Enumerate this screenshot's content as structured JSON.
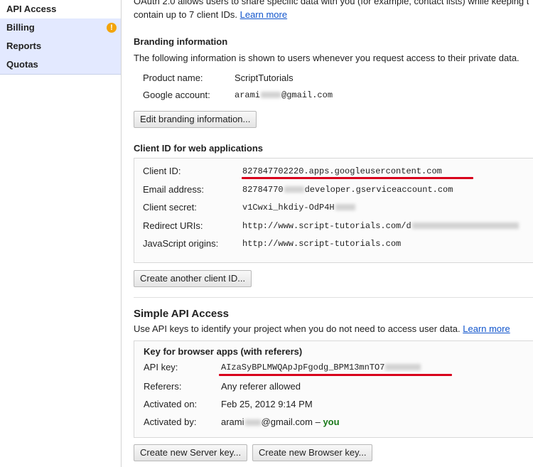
{
  "sidebar": {
    "items": [
      {
        "label": "API Access"
      },
      {
        "label": "Billing",
        "warning": "!"
      },
      {
        "label": "Reports"
      },
      {
        "label": "Quotas"
      }
    ]
  },
  "intro": {
    "line1": "OAuth 2.0 allows users to share specific data with you (for example, contact lists) while keeping t",
    "line2": "contain up to 7 client IDs.",
    "learn_more": "Learn more"
  },
  "branding": {
    "heading": "Branding information",
    "description": "The following information is shown to users whenever you request access to their private data.",
    "rows": [
      {
        "label": "Product name:",
        "value": "ScriptTutorials"
      },
      {
        "label": "Google account:",
        "value_prefix": "arami",
        "value_suffix": "@gmail.com"
      }
    ],
    "edit_button": "Edit branding information..."
  },
  "client_id": {
    "heading": "Client ID for web applications",
    "rows": [
      {
        "label": "Client ID:",
        "value": "827847702220.apps.googleusercontent.com"
      },
      {
        "label": "Email address:",
        "value_prefix": "82784770",
        "value_suffix": "developer.gserviceaccount.com"
      },
      {
        "label": "Client secret:",
        "value_prefix": "v1Cwxi_hkdiy-OdP4H"
      },
      {
        "label": "Redirect URIs:",
        "value_prefix": "http://www.script-tutorials.com/d"
      },
      {
        "label": "JavaScript origins:",
        "value": "http://www.script-tutorials.com"
      }
    ],
    "create_button": "Create another client ID..."
  },
  "simple_api": {
    "heading": "Simple API Access",
    "description": "Use API keys to identify your project when you do not need to access user data.",
    "learn_more": "Learn more",
    "panel_title": "Key for browser apps (with referers)",
    "rows": [
      {
        "label": "API key:",
        "value_prefix": "AIzaSyBPLMWQApJpFgodg_BPM13mnTO7"
      },
      {
        "label": "Referers:",
        "value": "Any referer allowed"
      },
      {
        "label": "Activated on:",
        "value": "Feb 25, 2012 9:14 PM"
      },
      {
        "label": "Activated by:",
        "value_prefix": "arami",
        "value_suffix": "@gmail.com",
        "dash": "–",
        "you": "you"
      }
    ],
    "server_key_button": "Create new Server key...",
    "browser_key_button": "Create new Browser key..."
  },
  "colors": {
    "link": "#1155cc",
    "highlight_underline": "#d8001c",
    "you": "#1a7a1a",
    "nav_bg": "#e3e9ff"
  }
}
